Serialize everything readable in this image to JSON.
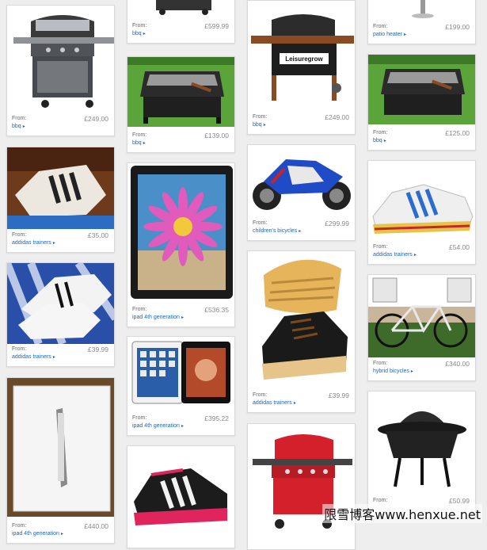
{
  "cards": [
    {
      "id": "c1",
      "from": "From:",
      "price": "£249.00",
      "category": "bbq"
    },
    {
      "id": "c2",
      "from": "From:",
      "price": "£35.00",
      "category": "addidas trainers"
    },
    {
      "id": "c3",
      "from": "From:",
      "price": "£39.99",
      "category": "addidas trainers"
    },
    {
      "id": "c4",
      "from": "From:",
      "price": "£440.00",
      "category": "ipad 4th generation"
    },
    {
      "id": "c5",
      "from": "From:",
      "price": "£599.99",
      "category": "bbq"
    },
    {
      "id": "c6",
      "from": "From:",
      "price": "£139.00",
      "category": "bbq"
    },
    {
      "id": "c7",
      "from": "From:",
      "price": "£536.35",
      "category": "ipad 4th generation"
    },
    {
      "id": "c8",
      "from": "From:",
      "price": "£395.22",
      "category": "ipad 4th generation"
    },
    {
      "id": "c9",
      "from": "",
      "price": "",
      "category": ""
    },
    {
      "id": "c10",
      "from": "From:",
      "price": "£249.00",
      "category": "bbq"
    },
    {
      "id": "c11",
      "from": "From:",
      "price": "£299.99",
      "category": "children's bicycles"
    },
    {
      "id": "c12",
      "from": "From:",
      "price": "£39.99",
      "category": "addidas trainers"
    },
    {
      "id": "c13",
      "from": "",
      "price": "",
      "category": ""
    },
    {
      "id": "c14",
      "from": "From:",
      "price": "£199.00",
      "category": "patio heater"
    },
    {
      "id": "c15",
      "from": "From:",
      "price": "£125.00",
      "category": "bbq"
    },
    {
      "id": "c16",
      "from": "From:",
      "price": "£54.00",
      "category": "addidas trainers"
    },
    {
      "id": "c17",
      "from": "From:",
      "price": "£340.00",
      "category": "hybrid bicycles"
    },
    {
      "id": "c18",
      "from": "From:",
      "price": "£50.99",
      "category": ""
    }
  ],
  "product_image_text": {
    "leisuregrow": "Leisuregrow"
  },
  "watermark": "限雪博客www.henxue.net"
}
